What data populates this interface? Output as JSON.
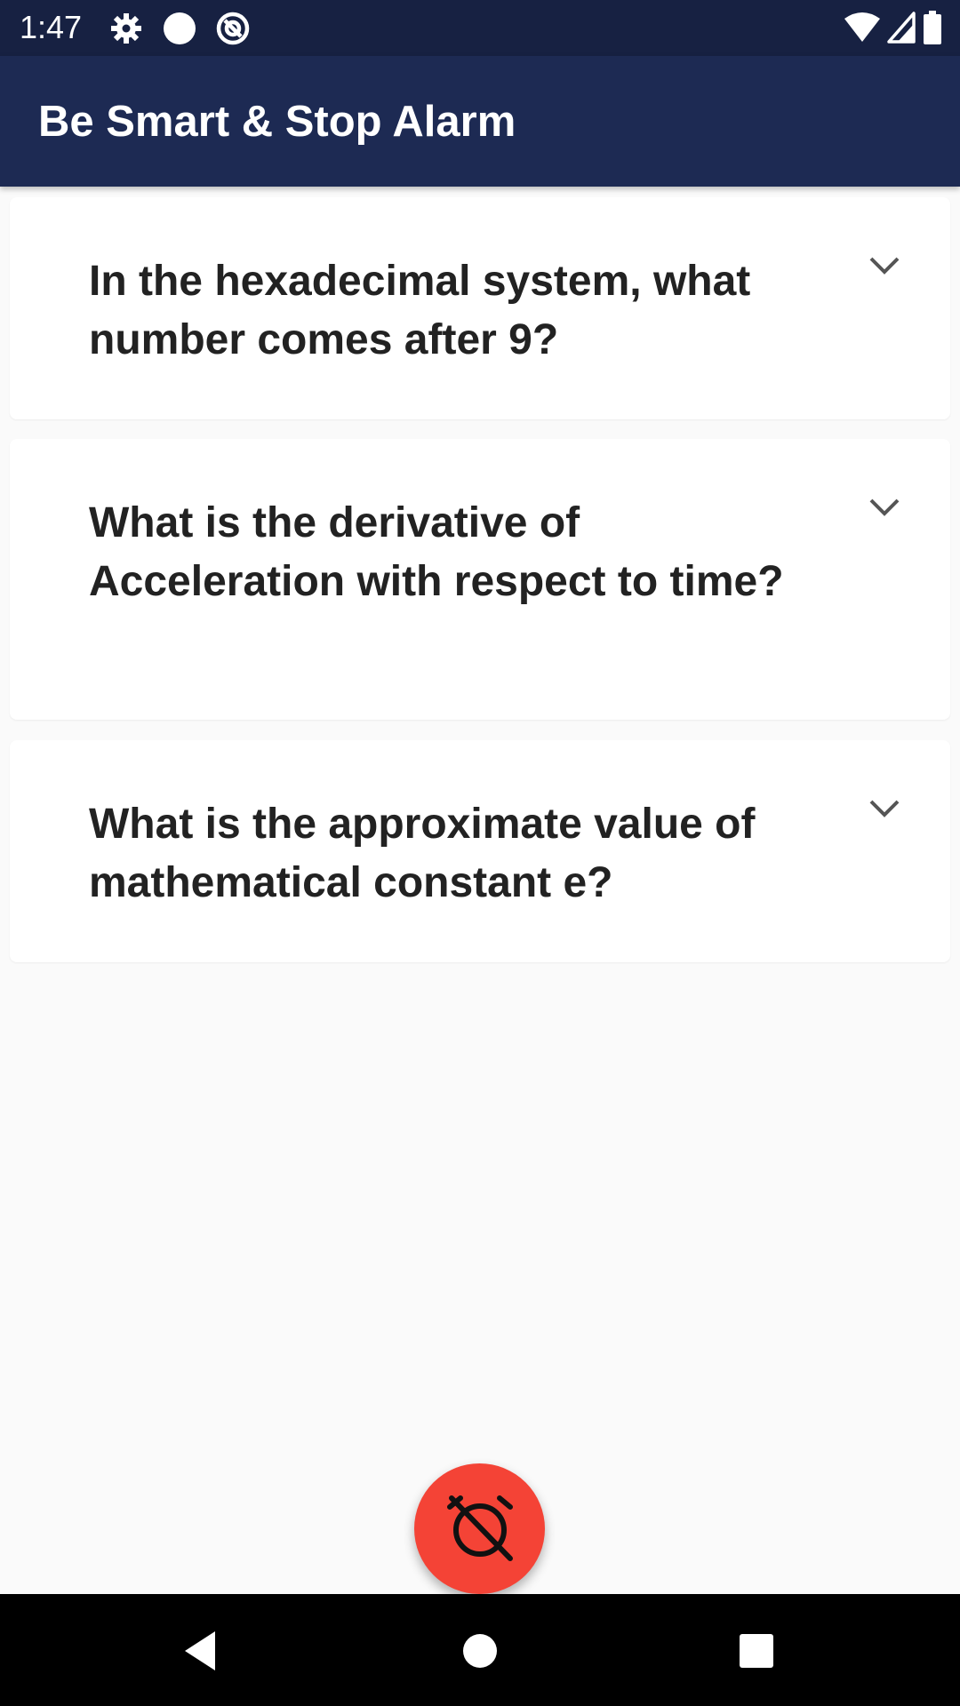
{
  "status_bar": {
    "time": "1:47",
    "left_icons": [
      "gear-icon",
      "circle-icon",
      "at-icon"
    ],
    "right_icons": [
      "wifi-icon",
      "cell-signal-icon",
      "battery-icon"
    ],
    "background": "#172142"
  },
  "app_bar": {
    "title": "Be Smart & Stop Alarm",
    "background": "#1d2a53"
  },
  "questions": [
    {
      "text": "In the hexadecimal system, what number comes after 9?",
      "icon": "chevron-down-icon"
    },
    {
      "text": "What is the derivative of Acceleration with respect to time?",
      "icon": "chevron-down-icon"
    },
    {
      "text": "What is the approximate value of mathematical constant e?",
      "icon": "chevron-down-icon"
    }
  ],
  "fab": {
    "icon": "alarm-off-icon",
    "color": "#f44336"
  },
  "nav_bar": {
    "buttons": [
      "back-icon",
      "home-icon",
      "recents-icon"
    ]
  }
}
